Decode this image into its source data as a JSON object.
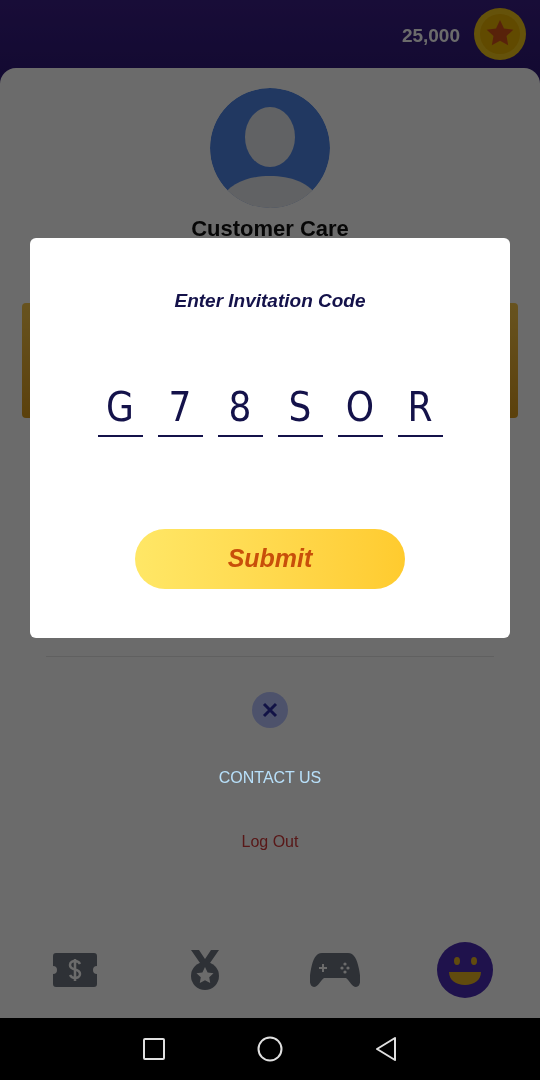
{
  "header": {
    "balance": "25,000"
  },
  "profile": {
    "name": "Customer Care"
  },
  "links": {
    "contact": "CONTACT US",
    "logout": "Log Out"
  },
  "bottom_nav": [
    {
      "kind": "ticket",
      "selected": false
    },
    {
      "kind": "medal",
      "selected": false
    },
    {
      "kind": "gamepad",
      "selected": false
    },
    {
      "kind": "smiley",
      "selected": true
    }
  ],
  "dialog": {
    "title": "Enter Invitation Code",
    "code": [
      "G",
      "7",
      "8",
      "S",
      "O",
      "R"
    ],
    "submit": "Submit"
  }
}
